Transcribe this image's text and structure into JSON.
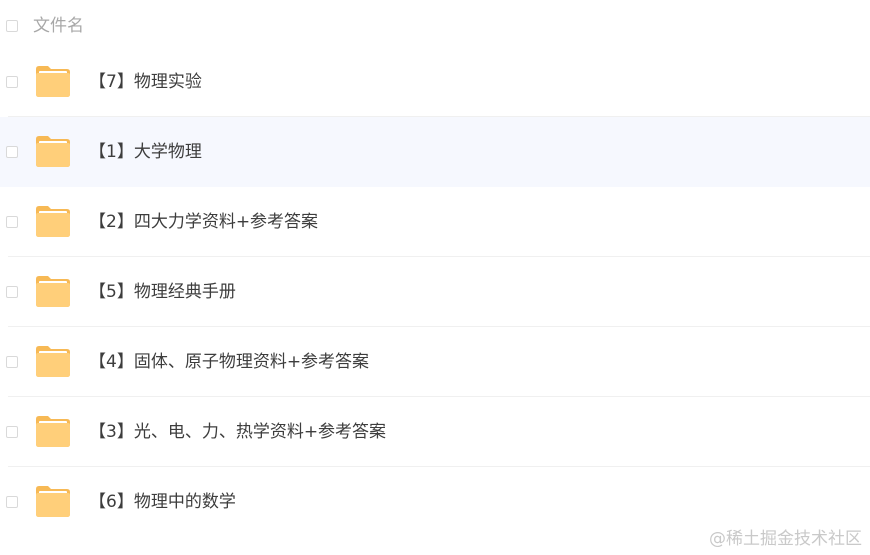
{
  "header": {
    "column_label": "文件名"
  },
  "rows": [
    {
      "label": "【7】物理实验",
      "icon": "folder-icon"
    },
    {
      "label": "【1】大学物理",
      "icon": "folder-icon"
    },
    {
      "label": "【2】四大力学资料+参考答案",
      "icon": "folder-icon"
    },
    {
      "label": "【5】物理经典手册",
      "icon": "folder-icon"
    },
    {
      "label": "【4】固体、原子物理资料+参考答案",
      "icon": "folder-icon"
    },
    {
      "label": "【3】光、电、力、热学资料+参考答案",
      "icon": "folder-icon"
    },
    {
      "label": "【6】物理中的数学",
      "icon": "folder-icon"
    }
  ],
  "watermark": "@稀土掘金技术社区",
  "colors": {
    "folder_body": "#ffcf7a",
    "folder_back": "#f7b955",
    "folder_paper": "#ffffff",
    "row_highlight": "#f6f8fe"
  }
}
